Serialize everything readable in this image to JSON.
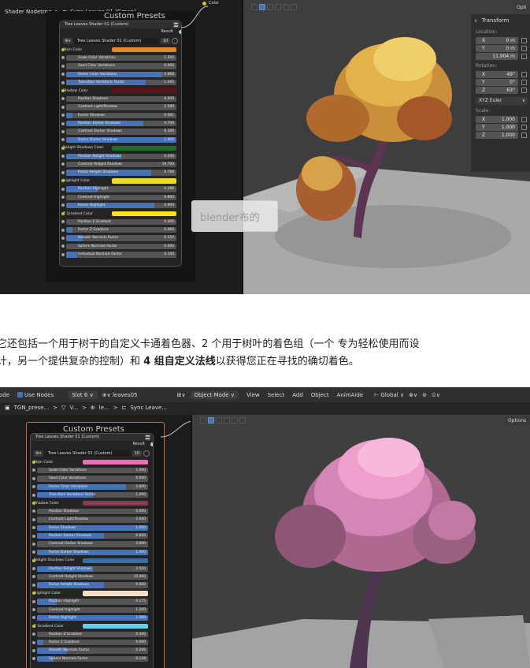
{
  "shot1": {
    "breadcrumb_left": "Shader Nodetree",
    "breadcrumb_sep": ">",
    "breadcrumb_right": "Sync Leaves 01 (Green)",
    "color_socket_label": "Color",
    "panel_title": "Custom Presets",
    "node_header": "Tree Leaves Shader 01 (Custom)",
    "result_label": "Result",
    "select_icon": "⊕∨",
    "select_name": "Tree Leaves Shader 01 (Custom)",
    "select_users": "10",
    "options_label": "Opti",
    "transform": {
      "header": "Transform",
      "location_label": "Location:",
      "location": [
        {
          "axis": "X",
          "value": "0 m"
        },
        {
          "axis": "Y",
          "value": "0 m"
        },
        {
          "axis": "",
          "value": "11.904 m"
        }
      ],
      "rotation_label": "Rotation:",
      "rotation": [
        {
          "axis": "X",
          "value": "49°"
        },
        {
          "axis": "Y",
          "value": "0°"
        },
        {
          "axis": "Z",
          "value": "63°"
        }
      ],
      "rotation_mode": "XYZ Euler",
      "scale_label": "Scale:",
      "scale": [
        {
          "axis": "X",
          "value": "1.000"
        },
        {
          "axis": "Y",
          "value": "1.000"
        },
        {
          "axis": "Z",
          "value": "1.000"
        }
      ]
    },
    "rows": [
      {
        "kind": "color",
        "label": "Main Color",
        "color": "#e08a2a"
      },
      {
        "kind": "val",
        "label": "Scale Color Variations",
        "value": "1.500",
        "fill": 0
      },
      {
        "kind": "val",
        "label": "Seed Color Variations",
        "value": "0.000",
        "fill": 0
      },
      {
        "kind": "val",
        "label": "Factor Color Variations",
        "value": "0.868",
        "fill": 0.868
      },
      {
        "kind": "val",
        "label": "Transition Variations Factor",
        "value": "1.445",
        "fill": 0.72
      },
      {
        "kind": "color",
        "label": "Shadow Color",
        "color": "#5a1616"
      },
      {
        "kind": "val",
        "label": "Position Shadows",
        "value": "0.000",
        "fill": 0
      },
      {
        "kind": "val",
        "label": "Contrast Light/Shadow",
        "value": "2.500",
        "fill": 0
      },
      {
        "kind": "val",
        "label": "Factor Shadows",
        "value": "0.061",
        "fill": 0.06
      },
      {
        "kind": "val",
        "label": "Position Darker Shadows",
        "value": "0.700",
        "fill": 0.7
      },
      {
        "kind": "val",
        "label": "Contrast Darker Shadows",
        "value": "6.300",
        "fill": 0
      },
      {
        "kind": "val",
        "label": "Factor Darker Shadows",
        "value": "1.000",
        "fill": 1
      },
      {
        "kind": "color",
        "label": "Relight Shadows Color",
        "color": "#1f6e2a"
      },
      {
        "kind": "val",
        "label": "Position Relight Shadows",
        "value": "0.500",
        "fill": 0.5
      },
      {
        "kind": "val",
        "label": "Contrast Relight Shadows",
        "value": "19.700",
        "fill": 0
      },
      {
        "kind": "val",
        "label": "Factor Relight Shadows",
        "value": "0.768",
        "fill": 0.768
      },
      {
        "kind": "color",
        "label": "Highlight Color",
        "color": "#f2d826"
      },
      {
        "kind": "val",
        "label": "Position Highlight",
        "value": "0.288",
        "fill": 0.288
      },
      {
        "kind": "val",
        "label": "Contrast Highlight",
        "value": "0.800",
        "fill": 0
      },
      {
        "kind": "val",
        "label": "Factor Highlight",
        "value": "0.800",
        "fill": 0.8
      },
      {
        "kind": "color",
        "label": "Z Gradient Color",
        "color": "#f7e318"
      },
      {
        "kind": "val",
        "label": "Position Z Gradient",
        "value": "0.300",
        "fill": 0
      },
      {
        "kind": "val",
        "label": "Factor Z Gradient",
        "value": "0.060",
        "fill": 0.06
      },
      {
        "kind": "val",
        "label": "Smooth Normals Factor",
        "value": "0.150",
        "fill": 0.15
      },
      {
        "kind": "val",
        "label": "Sphere Normals Factor",
        "value": "0.000",
        "fill": 0
      },
      {
        "kind": "val",
        "label": "Individual Normals Factor",
        "value": "0.100",
        "fill": 0.1
      }
    ]
  },
  "watermark": "blender布的",
  "article": {
    "line1": "它还包括一个用于树干的自定义卡通着色器、2 个用于树叶的着色组（一个 专为轻松使用而设",
    "line2_pre": "计，另一个提供复杂的控制）和 ",
    "line2_bold": "4 组自定义法线",
    "line2_post": "以获得您正在寻找的确切着色。"
  },
  "shot2": {
    "header": {
      "editor": "ode",
      "use_nodes": "Use Nodes",
      "slot": "Slot 6",
      "material": "leaves05",
      "mode": "Object Mode",
      "menu": [
        "View",
        "Select",
        "Add",
        "Object",
        "AnimAide"
      ],
      "transform_orientation": "Global",
      "options_label": "Options"
    },
    "breadcrumb": [
      "TGN_prese...",
      "V...",
      "le...",
      "Sync Leave..."
    ],
    "panel_title": "Custom Presets",
    "node_header": "Tree Leaves Shader 01 (Custom)",
    "result_label": "Result",
    "select_icon": "⊕∨",
    "select_name": "Tree Leaves Shader 01 (Custom)",
    "select_users": "10",
    "rows": [
      {
        "kind": "color",
        "label": "Main Color",
        "color": "#f06fb4"
      },
      {
        "kind": "val",
        "label": "Scale Color Variations",
        "value": "1.500",
        "fill": 0
      },
      {
        "kind": "val",
        "label": "Seed Color Variations",
        "value": "0.000",
        "fill": 0
      },
      {
        "kind": "val",
        "label": "Factor Color Variations",
        "value": "0.800",
        "fill": 0.8
      },
      {
        "kind": "val",
        "label": "Transition Variations Factor",
        "value": "1.000",
        "fill": 0.5
      },
      {
        "kind": "color",
        "label": "Shadow Color",
        "color": "#8a3c52"
      },
      {
        "kind": "val",
        "label": "Position Shadows",
        "value": "0.000",
        "fill": 0
      },
      {
        "kind": "val",
        "label": "Contrast Light/Shadow",
        "value": "2.500",
        "fill": 0
      },
      {
        "kind": "val",
        "label": "Factor Shadows",
        "value": "1.000",
        "fill": 1
      },
      {
        "kind": "val",
        "label": "Position Darker Shadows",
        "value": "0.600",
        "fill": 0.6
      },
      {
        "kind": "val",
        "label": "Contrast Darker Shadows",
        "value": "3.000",
        "fill": 0
      },
      {
        "kind": "val",
        "label": "Factor Darker Shadows",
        "value": "1.000",
        "fill": 1
      },
      {
        "kind": "color",
        "label": "Relight Shadows Color",
        "color": "#3a6fa6"
      },
      {
        "kind": "val",
        "label": "Position Relight Shadows",
        "value": "0.500",
        "fill": 0.5
      },
      {
        "kind": "val",
        "label": "Contrast Relight Shadows",
        "value": "15.000",
        "fill": 0
      },
      {
        "kind": "val",
        "label": "Factor Relight Shadows",
        "value": "0.600",
        "fill": 0.6
      },
      {
        "kind": "color",
        "label": "Highlight Color",
        "color": "#f5ddc8"
      },
      {
        "kind": "val",
        "label": "Position Highlight",
        "value": "0.175",
        "fill": 0.175
      },
      {
        "kind": "val",
        "label": "Contrast Highlight",
        "value": "1.500",
        "fill": 0
      },
      {
        "kind": "val",
        "label": "Factor Highlight",
        "value": "1.000",
        "fill": 1
      },
      {
        "kind": "color",
        "label": "Z Gradient Color",
        "color": "#5fd3ee"
      },
      {
        "kind": "val",
        "label": "Position Z Gradient",
        "value": "0.300",
        "fill": 0
      },
      {
        "kind": "val",
        "label": "Factor Z Gradient",
        "value": "0.060",
        "fill": 0.06
      },
      {
        "kind": "val",
        "label": "Smooth Normals Factor",
        "value": "0.266",
        "fill": 0.266
      },
      {
        "kind": "val",
        "label": "Sphere Normals Factor",
        "value": "0.148",
        "fill": 0.148
      }
    ]
  }
}
